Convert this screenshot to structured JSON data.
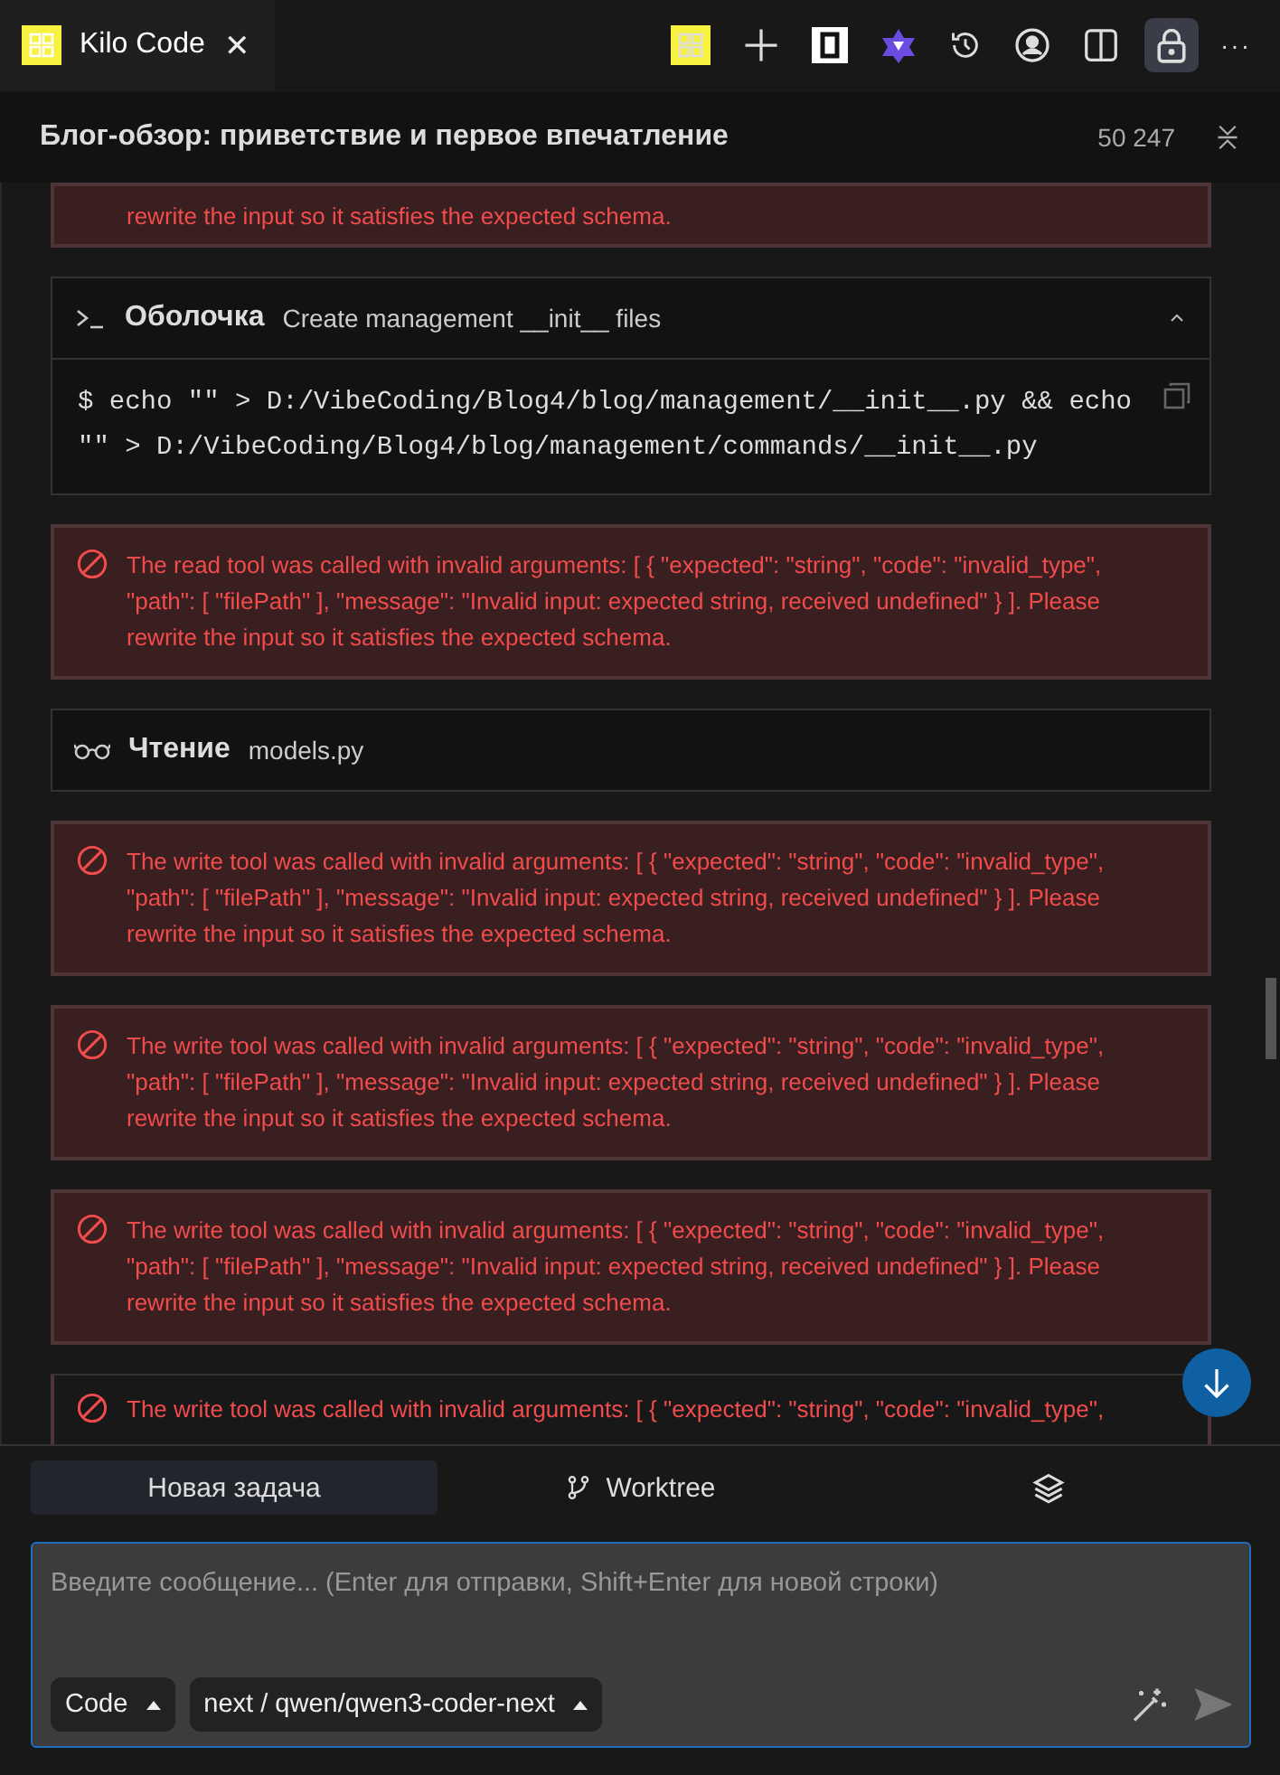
{
  "tab": {
    "title": "Kilo Code",
    "close": "✕"
  },
  "toolbar": {
    "more": "···"
  },
  "header": {
    "title": "Блог-обзор: приветствие и первое впечатление",
    "tokens": "50 247"
  },
  "messages": [
    {
      "kind": "error",
      "text": "rewrite the input so it satisfies the expected schema."
    },
    {
      "kind": "shell",
      "label": "Оболочка",
      "description": "Create management __init__ files",
      "expanded": true,
      "command": "$ echo \"\" > D:/VibeCoding/Blog4/blog/management/__init__.py && echo \"\" > D:/VibeCoding/Blog4/blog/management/commands/__init__.py"
    },
    {
      "kind": "error",
      "text": "The read tool was called with invalid arguments: [ { \"expected\": \"string\", \"code\": \"invalid_type\", \"path\": [ \"filePath\" ], \"message\": \"Invalid input: expected string, received undefined\" } ]. Please rewrite the input so it satisfies the expected schema."
    },
    {
      "kind": "read",
      "label": "Чтение",
      "file": "models.py"
    },
    {
      "kind": "error",
      "text": "The write tool was called with invalid arguments: [ { \"expected\": \"string\", \"code\": \"invalid_type\", \"path\": [ \"filePath\" ], \"message\": \"Invalid input: expected string, received undefined\" } ]. Please rewrite the input so it satisfies the expected schema."
    },
    {
      "kind": "error",
      "text": "The write tool was called with invalid arguments: [ { \"expected\": \"string\", \"code\": \"invalid_type\", \"path\": [ \"filePath\" ], \"message\": \"Invalid input: expected string, received undefined\" } ]. Please rewrite the input so it satisfies the expected schema."
    },
    {
      "kind": "error",
      "text": "The write tool was called with invalid arguments: [ { \"expected\": \"string\", \"code\": \"invalid_type\", \"path\": [ \"filePath\" ], \"message\": \"Invalid input: expected string, received undefined\" } ]. Please rewrite the input so it satisfies the expected schema."
    },
    {
      "kind": "error",
      "text": "The write tool was called with invalid arguments: [ { \"expected\": \"string\", \"code\": \"invalid_type\","
    }
  ],
  "bottom_tabs": [
    {
      "kind": "text",
      "label": "Новая задача",
      "selected": true
    },
    {
      "kind": "branch",
      "label": "Worktree",
      "selected": false
    },
    {
      "kind": "layers",
      "selected": false
    }
  ],
  "composer": {
    "placeholder": "Введите сообщение... (Enter для отправки, Shift+Enter для новой строки)",
    "mode": "Code",
    "model": "next / qwen/qwen3-coder-next"
  }
}
